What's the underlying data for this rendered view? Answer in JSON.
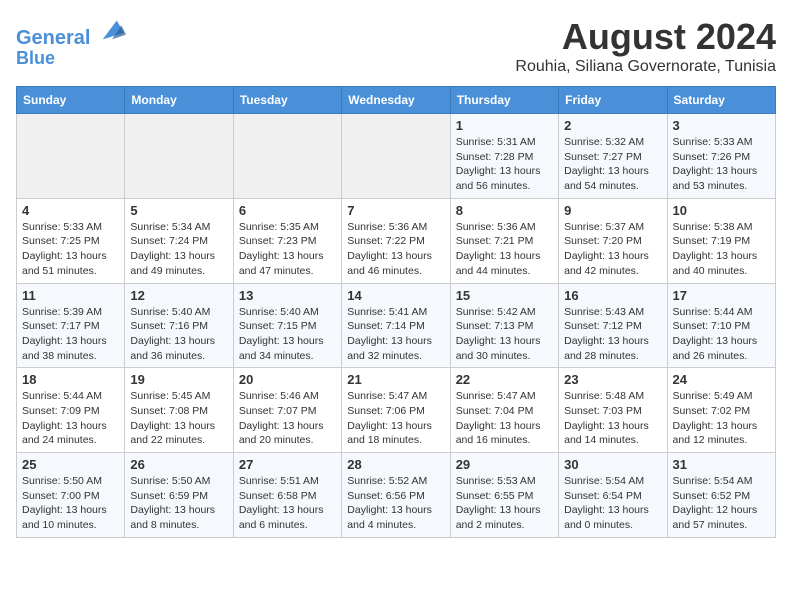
{
  "header": {
    "logo_line1": "General",
    "logo_line2": "Blue",
    "main_title": "August 2024",
    "subtitle": "Rouhia, Siliana Governorate, Tunisia"
  },
  "weekdays": [
    "Sunday",
    "Monday",
    "Tuesday",
    "Wednesday",
    "Thursday",
    "Friday",
    "Saturday"
  ],
  "weeks": [
    [
      {
        "day": "",
        "detail": ""
      },
      {
        "day": "",
        "detail": ""
      },
      {
        "day": "",
        "detail": ""
      },
      {
        "day": "",
        "detail": ""
      },
      {
        "day": "1",
        "detail": "Sunrise: 5:31 AM\nSunset: 7:28 PM\nDaylight: 13 hours\nand 56 minutes."
      },
      {
        "day": "2",
        "detail": "Sunrise: 5:32 AM\nSunset: 7:27 PM\nDaylight: 13 hours\nand 54 minutes."
      },
      {
        "day": "3",
        "detail": "Sunrise: 5:33 AM\nSunset: 7:26 PM\nDaylight: 13 hours\nand 53 minutes."
      }
    ],
    [
      {
        "day": "4",
        "detail": "Sunrise: 5:33 AM\nSunset: 7:25 PM\nDaylight: 13 hours\nand 51 minutes."
      },
      {
        "day": "5",
        "detail": "Sunrise: 5:34 AM\nSunset: 7:24 PM\nDaylight: 13 hours\nand 49 minutes."
      },
      {
        "day": "6",
        "detail": "Sunrise: 5:35 AM\nSunset: 7:23 PM\nDaylight: 13 hours\nand 47 minutes."
      },
      {
        "day": "7",
        "detail": "Sunrise: 5:36 AM\nSunset: 7:22 PM\nDaylight: 13 hours\nand 46 minutes."
      },
      {
        "day": "8",
        "detail": "Sunrise: 5:36 AM\nSunset: 7:21 PM\nDaylight: 13 hours\nand 44 minutes."
      },
      {
        "day": "9",
        "detail": "Sunrise: 5:37 AM\nSunset: 7:20 PM\nDaylight: 13 hours\nand 42 minutes."
      },
      {
        "day": "10",
        "detail": "Sunrise: 5:38 AM\nSunset: 7:19 PM\nDaylight: 13 hours\nand 40 minutes."
      }
    ],
    [
      {
        "day": "11",
        "detail": "Sunrise: 5:39 AM\nSunset: 7:17 PM\nDaylight: 13 hours\nand 38 minutes."
      },
      {
        "day": "12",
        "detail": "Sunrise: 5:40 AM\nSunset: 7:16 PM\nDaylight: 13 hours\nand 36 minutes."
      },
      {
        "day": "13",
        "detail": "Sunrise: 5:40 AM\nSunset: 7:15 PM\nDaylight: 13 hours\nand 34 minutes."
      },
      {
        "day": "14",
        "detail": "Sunrise: 5:41 AM\nSunset: 7:14 PM\nDaylight: 13 hours\nand 32 minutes."
      },
      {
        "day": "15",
        "detail": "Sunrise: 5:42 AM\nSunset: 7:13 PM\nDaylight: 13 hours\nand 30 minutes."
      },
      {
        "day": "16",
        "detail": "Sunrise: 5:43 AM\nSunset: 7:12 PM\nDaylight: 13 hours\nand 28 minutes."
      },
      {
        "day": "17",
        "detail": "Sunrise: 5:44 AM\nSunset: 7:10 PM\nDaylight: 13 hours\nand 26 minutes."
      }
    ],
    [
      {
        "day": "18",
        "detail": "Sunrise: 5:44 AM\nSunset: 7:09 PM\nDaylight: 13 hours\nand 24 minutes."
      },
      {
        "day": "19",
        "detail": "Sunrise: 5:45 AM\nSunset: 7:08 PM\nDaylight: 13 hours\nand 22 minutes."
      },
      {
        "day": "20",
        "detail": "Sunrise: 5:46 AM\nSunset: 7:07 PM\nDaylight: 13 hours\nand 20 minutes."
      },
      {
        "day": "21",
        "detail": "Sunrise: 5:47 AM\nSunset: 7:06 PM\nDaylight: 13 hours\nand 18 minutes."
      },
      {
        "day": "22",
        "detail": "Sunrise: 5:47 AM\nSunset: 7:04 PM\nDaylight: 13 hours\nand 16 minutes."
      },
      {
        "day": "23",
        "detail": "Sunrise: 5:48 AM\nSunset: 7:03 PM\nDaylight: 13 hours\nand 14 minutes."
      },
      {
        "day": "24",
        "detail": "Sunrise: 5:49 AM\nSunset: 7:02 PM\nDaylight: 13 hours\nand 12 minutes."
      }
    ],
    [
      {
        "day": "25",
        "detail": "Sunrise: 5:50 AM\nSunset: 7:00 PM\nDaylight: 13 hours\nand 10 minutes."
      },
      {
        "day": "26",
        "detail": "Sunrise: 5:50 AM\nSunset: 6:59 PM\nDaylight: 13 hours\nand 8 minutes."
      },
      {
        "day": "27",
        "detail": "Sunrise: 5:51 AM\nSunset: 6:58 PM\nDaylight: 13 hours\nand 6 minutes."
      },
      {
        "day": "28",
        "detail": "Sunrise: 5:52 AM\nSunset: 6:56 PM\nDaylight: 13 hours\nand 4 minutes."
      },
      {
        "day": "29",
        "detail": "Sunrise: 5:53 AM\nSunset: 6:55 PM\nDaylight: 13 hours\nand 2 minutes."
      },
      {
        "day": "30",
        "detail": "Sunrise: 5:54 AM\nSunset: 6:54 PM\nDaylight: 13 hours\nand 0 minutes."
      },
      {
        "day": "31",
        "detail": "Sunrise: 5:54 AM\nSunset: 6:52 PM\nDaylight: 12 hours\nand 57 minutes."
      }
    ]
  ]
}
